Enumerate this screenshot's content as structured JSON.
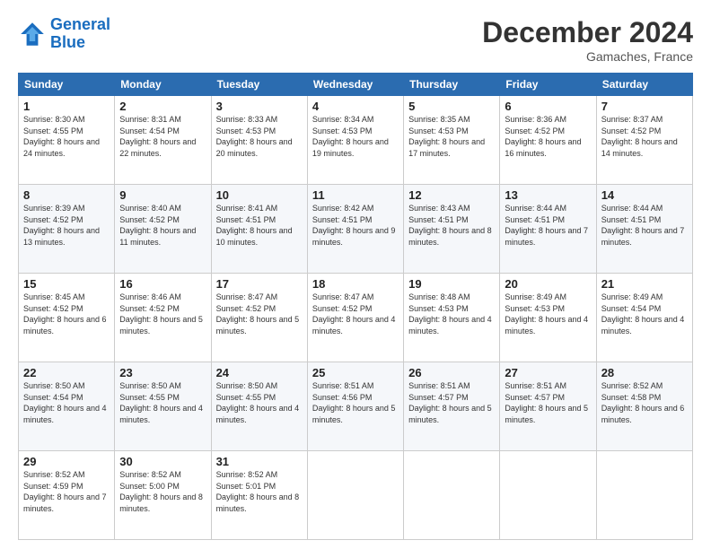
{
  "header": {
    "logo_line1": "General",
    "logo_line2": "Blue",
    "month_title": "December 2024",
    "location": "Gamaches, France"
  },
  "days_of_week": [
    "Sunday",
    "Monday",
    "Tuesday",
    "Wednesday",
    "Thursday",
    "Friday",
    "Saturday"
  ],
  "weeks": [
    [
      {
        "day": "1",
        "sunrise": "8:30 AM",
        "sunset": "4:55 PM",
        "daylight": "8 hours and 24 minutes."
      },
      {
        "day": "2",
        "sunrise": "8:31 AM",
        "sunset": "4:54 PM",
        "daylight": "8 hours and 22 minutes."
      },
      {
        "day": "3",
        "sunrise": "8:33 AM",
        "sunset": "4:53 PM",
        "daylight": "8 hours and 20 minutes."
      },
      {
        "day": "4",
        "sunrise": "8:34 AM",
        "sunset": "4:53 PM",
        "daylight": "8 hours and 19 minutes."
      },
      {
        "day": "5",
        "sunrise": "8:35 AM",
        "sunset": "4:53 PM",
        "daylight": "8 hours and 17 minutes."
      },
      {
        "day": "6",
        "sunrise": "8:36 AM",
        "sunset": "4:52 PM",
        "daylight": "8 hours and 16 minutes."
      },
      {
        "day": "7",
        "sunrise": "8:37 AM",
        "sunset": "4:52 PM",
        "daylight": "8 hours and 14 minutes."
      }
    ],
    [
      {
        "day": "8",
        "sunrise": "8:39 AM",
        "sunset": "4:52 PM",
        "daylight": "8 hours and 13 minutes."
      },
      {
        "day": "9",
        "sunrise": "8:40 AM",
        "sunset": "4:52 PM",
        "daylight": "8 hours and 11 minutes."
      },
      {
        "day": "10",
        "sunrise": "8:41 AM",
        "sunset": "4:51 PM",
        "daylight": "8 hours and 10 minutes."
      },
      {
        "day": "11",
        "sunrise": "8:42 AM",
        "sunset": "4:51 PM",
        "daylight": "8 hours and 9 minutes."
      },
      {
        "day": "12",
        "sunrise": "8:43 AM",
        "sunset": "4:51 PM",
        "daylight": "8 hours and 8 minutes."
      },
      {
        "day": "13",
        "sunrise": "8:44 AM",
        "sunset": "4:51 PM",
        "daylight": "8 hours and 7 minutes."
      },
      {
        "day": "14",
        "sunrise": "8:44 AM",
        "sunset": "4:51 PM",
        "daylight": "8 hours and 7 minutes."
      }
    ],
    [
      {
        "day": "15",
        "sunrise": "8:45 AM",
        "sunset": "4:52 PM",
        "daylight": "8 hours and 6 minutes."
      },
      {
        "day": "16",
        "sunrise": "8:46 AM",
        "sunset": "4:52 PM",
        "daylight": "8 hours and 5 minutes."
      },
      {
        "day": "17",
        "sunrise": "8:47 AM",
        "sunset": "4:52 PM",
        "daylight": "8 hours and 5 minutes."
      },
      {
        "day": "18",
        "sunrise": "8:47 AM",
        "sunset": "4:52 PM",
        "daylight": "8 hours and 4 minutes."
      },
      {
        "day": "19",
        "sunrise": "8:48 AM",
        "sunset": "4:53 PM",
        "daylight": "8 hours and 4 minutes."
      },
      {
        "day": "20",
        "sunrise": "8:49 AM",
        "sunset": "4:53 PM",
        "daylight": "8 hours and 4 minutes."
      },
      {
        "day": "21",
        "sunrise": "8:49 AM",
        "sunset": "4:54 PM",
        "daylight": "8 hours and 4 minutes."
      }
    ],
    [
      {
        "day": "22",
        "sunrise": "8:50 AM",
        "sunset": "4:54 PM",
        "daylight": "8 hours and 4 minutes."
      },
      {
        "day": "23",
        "sunrise": "8:50 AM",
        "sunset": "4:55 PM",
        "daylight": "8 hours and 4 minutes."
      },
      {
        "day": "24",
        "sunrise": "8:50 AM",
        "sunset": "4:55 PM",
        "daylight": "8 hours and 4 minutes."
      },
      {
        "day": "25",
        "sunrise": "8:51 AM",
        "sunset": "4:56 PM",
        "daylight": "8 hours and 5 minutes."
      },
      {
        "day": "26",
        "sunrise": "8:51 AM",
        "sunset": "4:57 PM",
        "daylight": "8 hours and 5 minutes."
      },
      {
        "day": "27",
        "sunrise": "8:51 AM",
        "sunset": "4:57 PM",
        "daylight": "8 hours and 5 minutes."
      },
      {
        "day": "28",
        "sunrise": "8:52 AM",
        "sunset": "4:58 PM",
        "daylight": "8 hours and 6 minutes."
      }
    ],
    [
      {
        "day": "29",
        "sunrise": "8:52 AM",
        "sunset": "4:59 PM",
        "daylight": "8 hours and 7 minutes."
      },
      {
        "day": "30",
        "sunrise": "8:52 AM",
        "sunset": "5:00 PM",
        "daylight": "8 hours and 8 minutes."
      },
      {
        "day": "31",
        "sunrise": "8:52 AM",
        "sunset": "5:01 PM",
        "daylight": "8 hours and 8 minutes."
      },
      null,
      null,
      null,
      null
    ]
  ]
}
